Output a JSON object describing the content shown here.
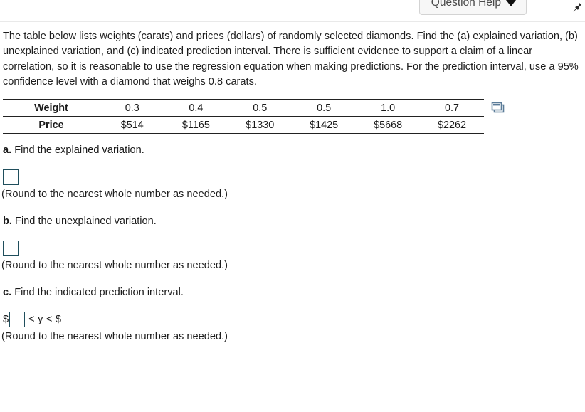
{
  "header": {
    "help_button_label": "Question Help",
    "help_caret_icon": "chevron-down-icon",
    "corner_icon": "pushpin-icon"
  },
  "statement": {
    "text": "The table below lists weights (carats) and prices (dollars) of randomly selected diamonds. Find the (a) explained variation, (b) unexplained variation, and (c) indicated prediction interval. There is sufficient evidence to support a claim of a linear correlation, so it is reasonable to use the regression equation when making predictions. For the prediction interval, use a 95% confidence level with a diamond that weighs 0.8 carats."
  },
  "table": {
    "row_labels": [
      "Weight",
      "Price"
    ],
    "weights": [
      "0.3",
      "0.4",
      "0.5",
      "0.5",
      "1.0",
      "0.7"
    ],
    "prices": [
      "$514",
      "$1165",
      "$1330",
      "$1425",
      "$5668",
      "$2262"
    ],
    "copy_icon": "copy-to-spreadsheet-icon"
  },
  "parts": [
    {
      "tag": "a.",
      "prompt": " Find the explained variation.",
      "input_value": "",
      "note": "(Round to the nearest whole number as needed.)"
    },
    {
      "tag": "b.",
      "prompt": " Find the unexplained variation.",
      "input_value": "",
      "note": "(Round to the nearest whole number as needed.)"
    },
    {
      "tag": "c.",
      "prompt": " Find the indicated prediction interval.",
      "input_value_lower": "",
      "input_value_upper": "",
      "currency_symbol_left": "$",
      "inequality_middle": "< y < $",
      "note": "(Round to the nearest whole number as needed.)"
    }
  ],
  "colors": {
    "input_border": "#1f4e5c",
    "table_rule": "#222222",
    "divider": "#ebebeb",
    "button_bg": "#f7f7f7",
    "icon_blue": "#5b7c99"
  }
}
